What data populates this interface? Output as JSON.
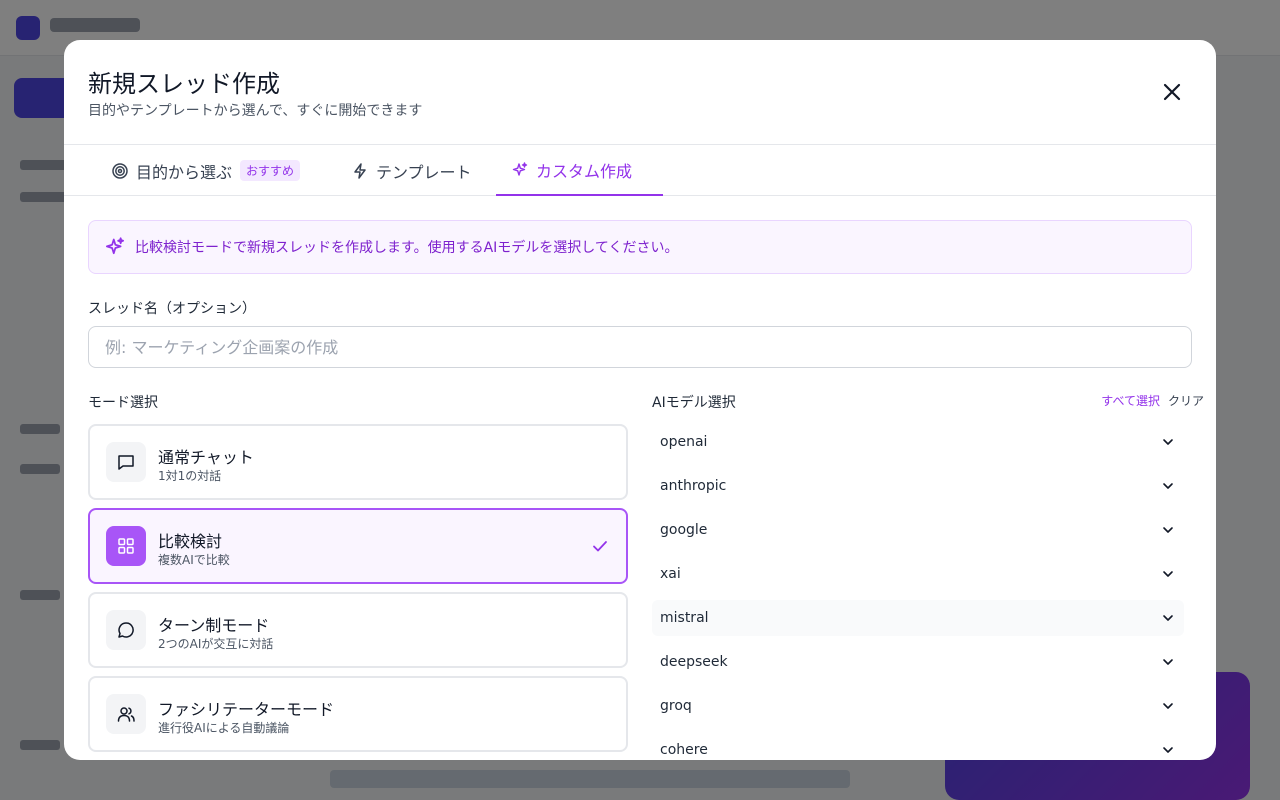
{
  "modal": {
    "title": "新規スレッド作成",
    "subtitle": "目的やテンプレートから選んで、すぐに開始できます"
  },
  "tabs": [
    {
      "label": "目的から選ぶ",
      "badge": "おすすめ",
      "icon": "target-icon"
    },
    {
      "label": "テンプレート",
      "icon": "lightning-icon"
    },
    {
      "label": "カスタム作成",
      "icon": "sparkles-icon",
      "active": true
    }
  ],
  "banner": {
    "text": "比較検討モードで新規スレッドを作成します。使用するAIモデルを選択してください。",
    "icon": "sparkles-icon"
  },
  "thread_name": {
    "label": "スレッド名（オプション）",
    "placeholder": "例: マーケティング企画案の作成",
    "value": ""
  },
  "mode_section": {
    "label": "モード選択",
    "modes": [
      {
        "title": "通常チャット",
        "desc": "1対1の対話",
        "icon": "message-square-icon",
        "selected": false
      },
      {
        "title": "比較検討",
        "desc": "複数AIで比較",
        "icon": "grid-icon",
        "selected": true
      },
      {
        "title": "ターン制モード",
        "desc": "2つのAIが交互に対話",
        "icon": "message-circle-icon",
        "selected": false
      },
      {
        "title": "ファシリテーターモード",
        "desc": "進行役AIによる自動議論",
        "icon": "users-icon",
        "selected": false
      }
    ]
  },
  "model_section": {
    "label": "AIモデル選択",
    "select_all": "すべて選択",
    "clear": "クリア",
    "providers": [
      "openai",
      "anthropic",
      "google",
      "xai",
      "mistral",
      "deepseek",
      "groq",
      "cohere"
    ]
  },
  "colors": {
    "accent": "#9333ea",
    "accent_light": "#faf5ff",
    "selected_icon_bg": "#a855f7"
  }
}
